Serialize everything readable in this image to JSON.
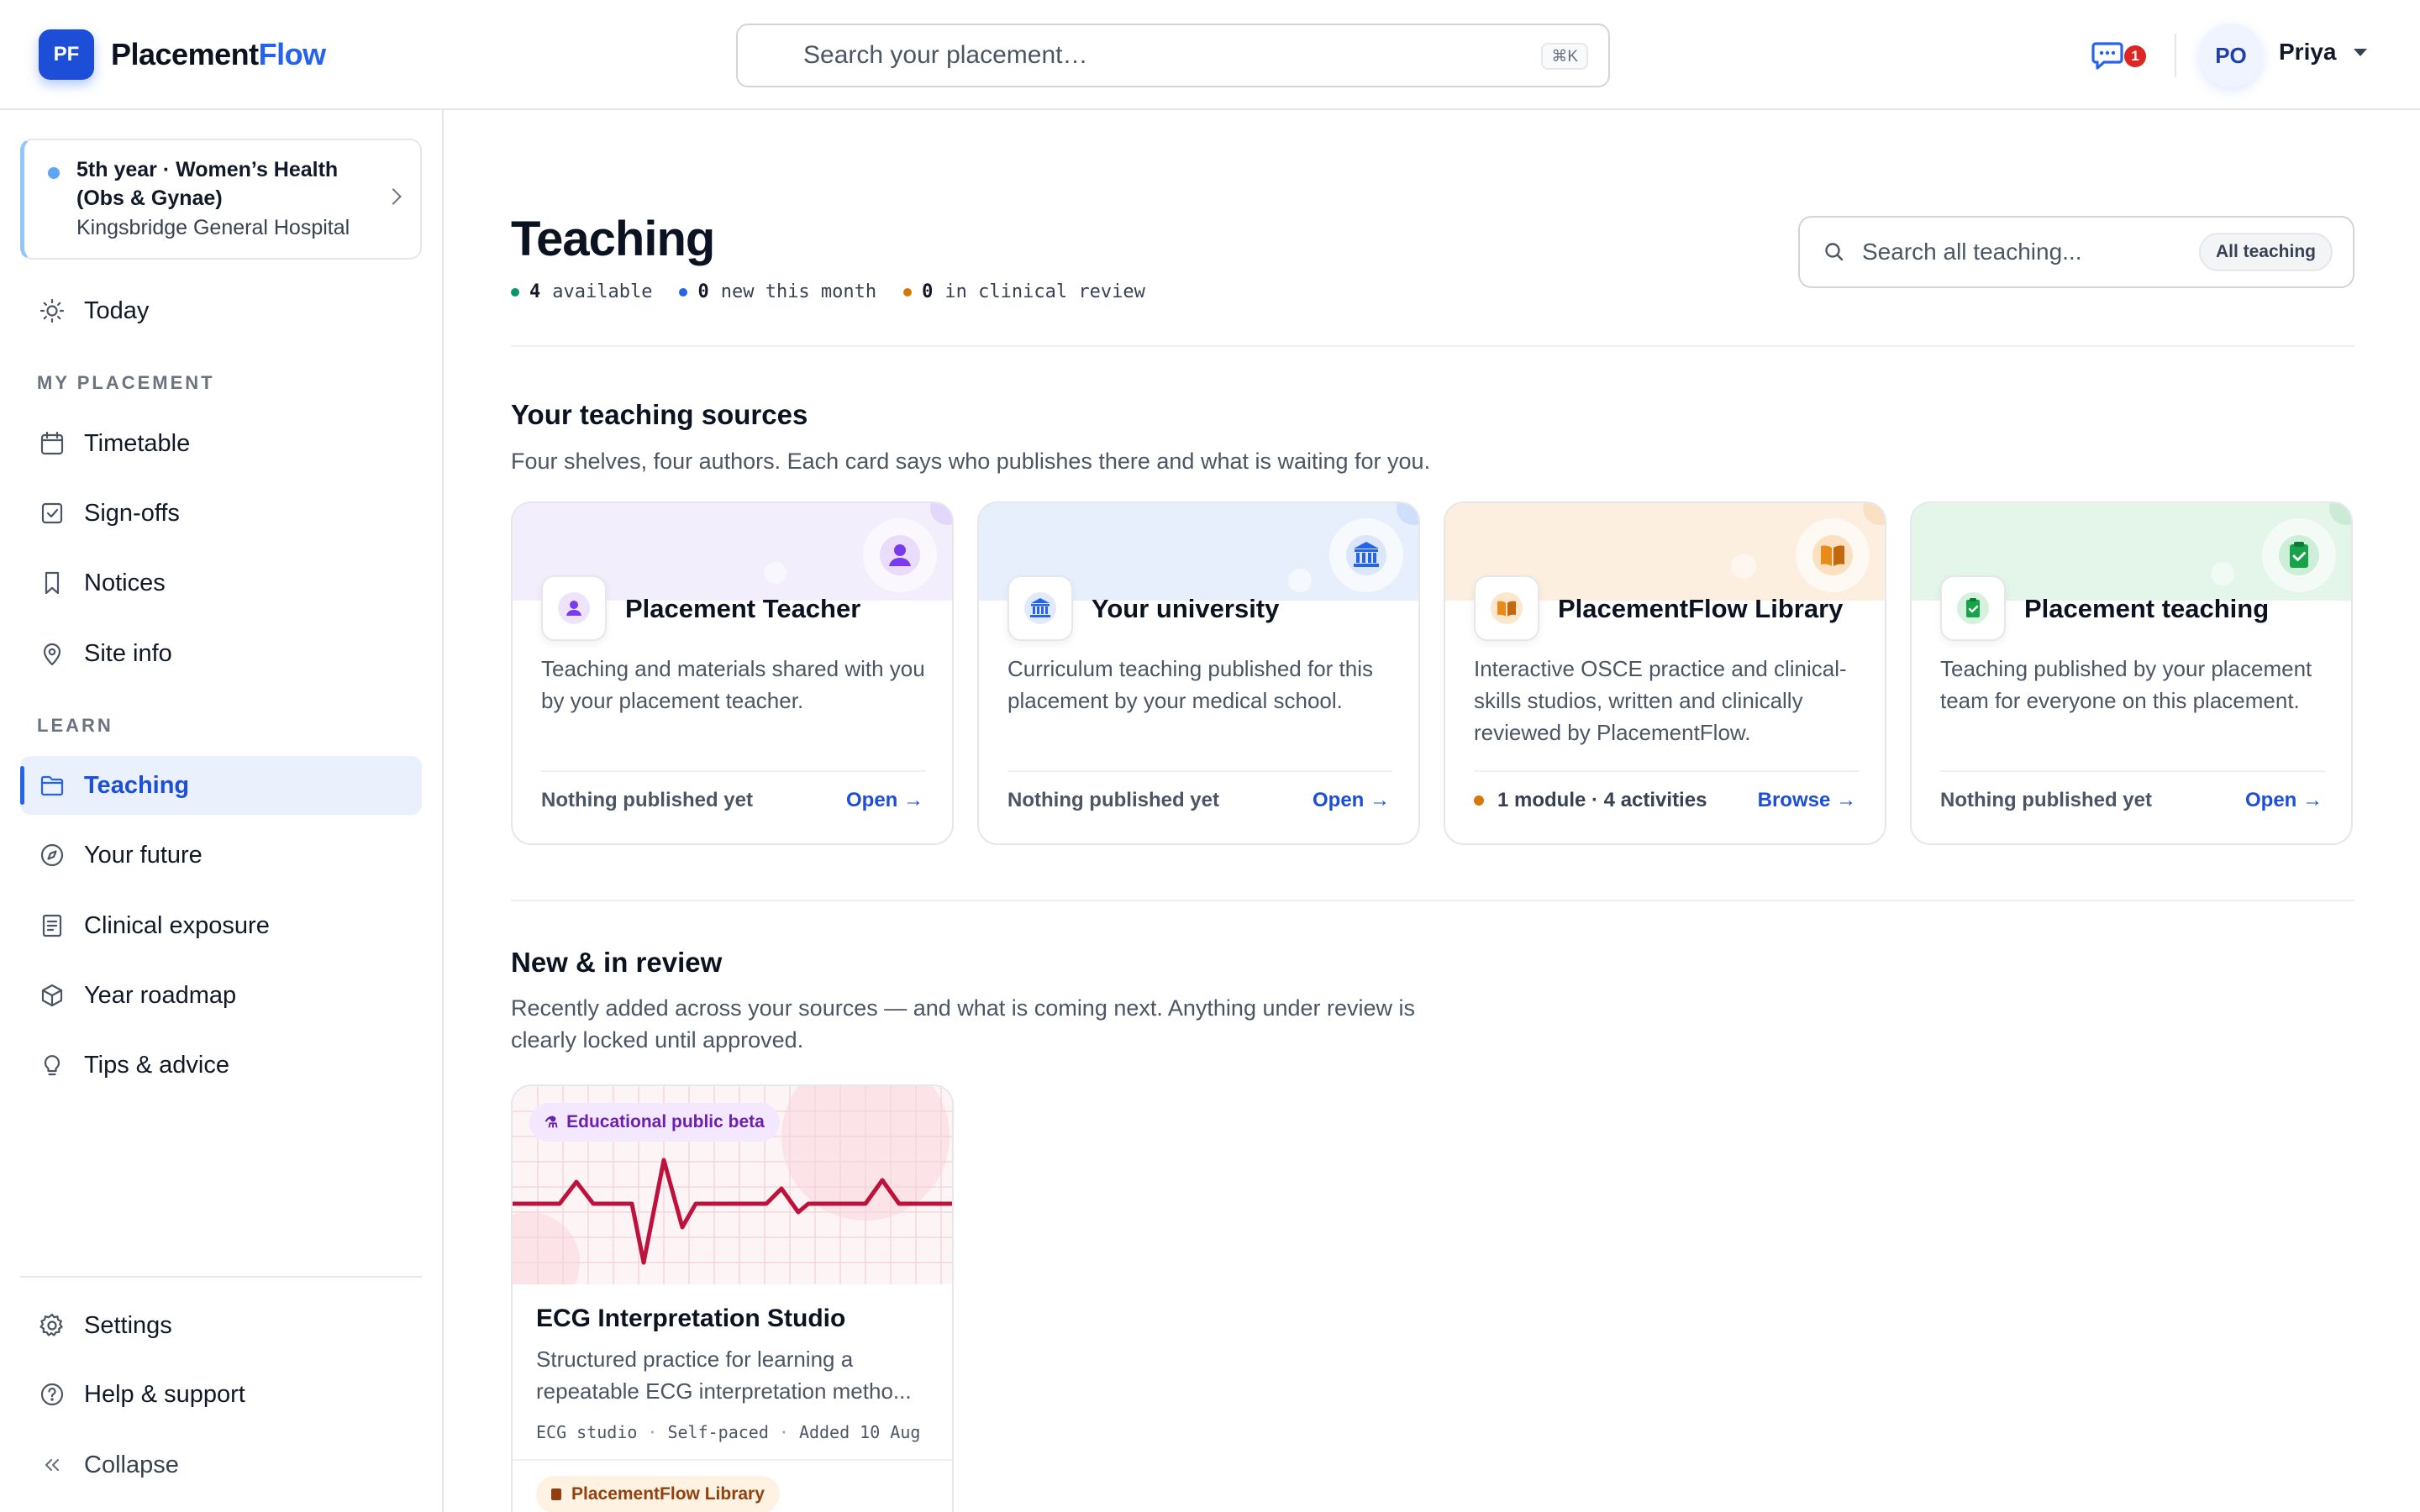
{
  "brand": {
    "initials": "PF",
    "name_part1": "Placement",
    "name_part2": "Flow"
  },
  "header": {
    "search_placeholder": "Search your placement…",
    "shortcut": "⌘K",
    "notifications_count": "1",
    "user_initials": "PO",
    "user_name": "Priya"
  },
  "sidebar": {
    "placement": {
      "title": "5th year · Women’s Health (Obs & Gynae)",
      "hospital": "Kingsbridge General Hospital"
    },
    "today": "Today",
    "sections": {
      "my_placement": "MY PLACEMENT",
      "learn": "LEARN"
    },
    "my_placement_items": [
      {
        "label": "Timetable",
        "icon": "calendar-icon"
      },
      {
        "label": "Sign-offs",
        "icon": "checkbox-icon"
      },
      {
        "label": "Notices",
        "icon": "bookmark-icon"
      },
      {
        "label": "Site info",
        "icon": "map-pin-icon"
      }
    ],
    "learn_items": [
      {
        "label": "Teaching",
        "icon": "folder-icon",
        "active": true
      },
      {
        "label": "Your future",
        "icon": "compass-icon"
      },
      {
        "label": "Clinical exposure",
        "icon": "document-icon"
      },
      {
        "label": "Year roadmap",
        "icon": "cube-icon"
      },
      {
        "label": "Tips & advice",
        "icon": "lightbulb-icon"
      }
    ],
    "settings": "Settings",
    "help": "Help & support",
    "collapse": "Collapse"
  },
  "page": {
    "title": "Teaching",
    "stats": [
      {
        "count": "4",
        "label": "available",
        "color": "#059669"
      },
      {
        "count": "0",
        "label": "new this month",
        "color": "#2563eb"
      },
      {
        "count": "0",
        "label": "in clinical review",
        "color": "#d97706"
      }
    ],
    "search_placeholder": "Search all teaching...",
    "search_scope": "All teaching"
  },
  "sources": {
    "heading": "Your teaching sources",
    "subheading": "Four shelves, four authors. Each card says who publishes there and what is waiting for you.",
    "cards": [
      {
        "title": "Placement Teacher",
        "description": "Teaching and materials shared with you by your placement teacher.",
        "status": "Nothing published yet",
        "action": "Open →",
        "icon": "person-icon",
        "accent": "#7c3aed",
        "band": "#f3eefc"
      },
      {
        "title": "Your university",
        "description": "Curriculum teaching published for this placement by your medical school.",
        "status": "Nothing published yet",
        "action": "Open →",
        "icon": "university-icon",
        "accent": "#2563eb",
        "band": "#e8effc"
      },
      {
        "title": "PlacementFlow Library",
        "description": "Interactive OSCE practice and clinical-skills studios, written and clinically reviewed by PlacementFlow.",
        "status": "1 module · 4 activities",
        "action": "Browse →",
        "icon": "book-icon",
        "accent": "#ea8a1a",
        "band": "#fdefdf"
      },
      {
        "title": "Placement teaching",
        "description": "Teaching published by your placement team for everyone on this placement.",
        "status": "Nothing published yet",
        "action": "Open →",
        "icon": "clipboard-check-icon",
        "accent": "#16a34a",
        "band": "#e4f5ea"
      }
    ]
  },
  "review": {
    "heading": "New & in review",
    "subheading": "Recently added across your sources — and what is coming next. Anything under review is clearly locked until approved.",
    "card": {
      "badge": "Educational public beta",
      "title": "ECG Interpretation Studio",
      "description": "Structured practice for learning a repeatable ECG interpretation metho...",
      "meta": [
        "ECG studio",
        "Self-paced",
        "Added 10 Aug"
      ],
      "source": "PlacementFlow Library",
      "ecg_color": "#be123c"
    }
  }
}
